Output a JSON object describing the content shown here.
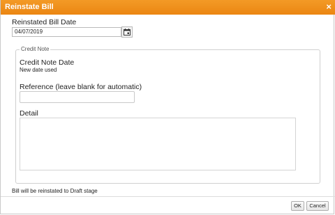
{
  "dialog": {
    "title": "Reinstate Bill",
    "close_glyph": "×"
  },
  "reinstated_date": {
    "label": "Reinstated Bill Date",
    "value": "04/07/2019",
    "calendar_icon": "calendar-icon"
  },
  "credit_note": {
    "legend": "Credit Note",
    "date_label": "Credit Note Date",
    "date_value": "New date used",
    "reference_label": "Reference (leave blank for automatic)",
    "reference_value": "",
    "detail_label": "Detail",
    "detail_value": ""
  },
  "info_text": "Bill will be reinstated to Draft stage",
  "buttons": {
    "ok_label": "OK",
    "cancel_label": "Cancel"
  },
  "colors": {
    "titlebar": "#ef8f1a"
  }
}
